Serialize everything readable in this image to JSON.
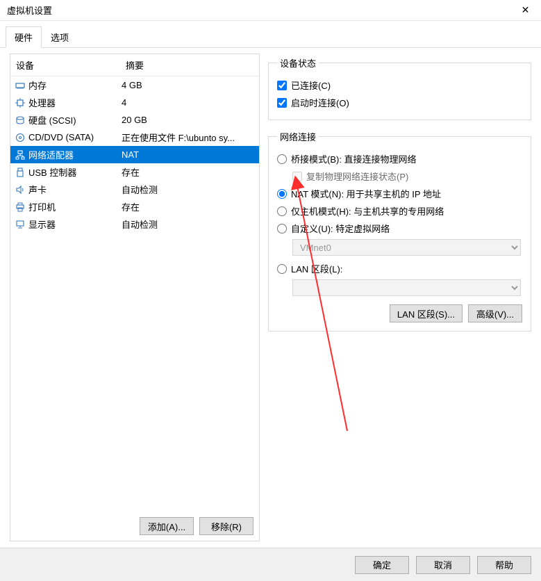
{
  "window": {
    "title": "虚拟机设置"
  },
  "tabs": {
    "hardware": "硬件",
    "options": "选项"
  },
  "list": {
    "header_device": "设备",
    "header_summary": "摘要",
    "items": [
      {
        "icon": "memory-icon",
        "label": "内存",
        "summary": "4 GB"
      },
      {
        "icon": "cpu-icon",
        "label": "处理器",
        "summary": "4"
      },
      {
        "icon": "disk-icon",
        "label": "硬盘 (SCSI)",
        "summary": "20 GB"
      },
      {
        "icon": "cd-icon",
        "label": "CD/DVD (SATA)",
        "summary": "正在使用文件 F:\\ubunto sy..."
      },
      {
        "icon": "network-icon",
        "label": "网络适配器",
        "summary": "NAT"
      },
      {
        "icon": "usb-icon",
        "label": "USB 控制器",
        "summary": "存在"
      },
      {
        "icon": "sound-icon",
        "label": "声卡",
        "summary": "自动检测"
      },
      {
        "icon": "printer-icon",
        "label": "打印机",
        "summary": "存在"
      },
      {
        "icon": "display-icon",
        "label": "显示器",
        "summary": "自动检测"
      }
    ]
  },
  "buttons": {
    "add": "添加(A)...",
    "remove": "移除(R)",
    "lan_segments": "LAN 区段(S)...",
    "advanced": "高级(V)...",
    "ok": "确定",
    "cancel": "取消",
    "help": "帮助"
  },
  "device_status": {
    "legend": "设备状态",
    "connected": "已连接(C)",
    "connect_at_power": "启动时连接(O)"
  },
  "network": {
    "legend": "网络连接",
    "bridged": "桥接模式(B): 直接连接物理网络",
    "replicate": "复制物理网络连接状态(P)",
    "nat": "NAT 模式(N): 用于共享主机的 IP 地址",
    "hostonly": "仅主机模式(H): 与主机共享的专用网络",
    "custom": "自定义(U): 特定虚拟网络",
    "vmnet_value": "VMnet0",
    "lan_segment_radio": "LAN 区段(L):"
  }
}
